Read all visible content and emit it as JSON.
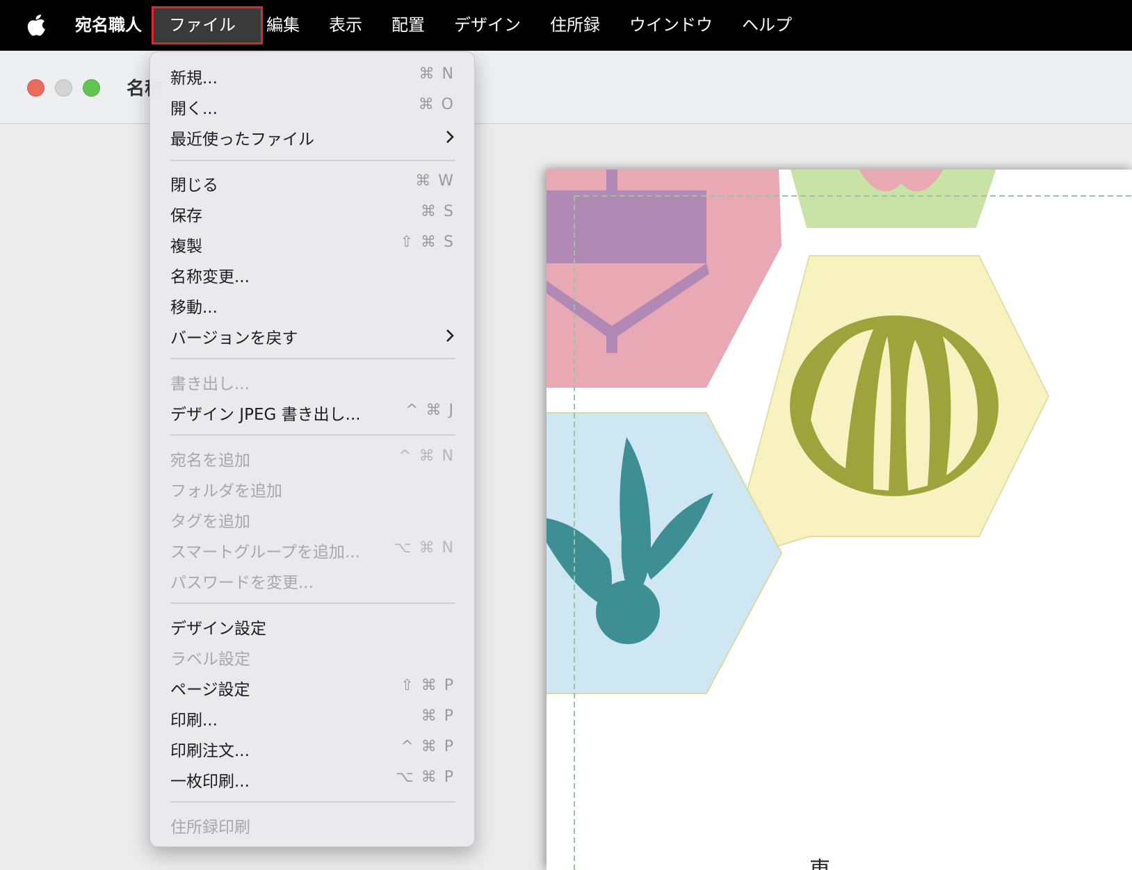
{
  "menubar": {
    "app_name": "宛名職人",
    "items": [
      "ファイル",
      "編集",
      "表示",
      "配置",
      "デザイン",
      "住所録",
      "ウインドウ",
      "ヘルプ"
    ]
  },
  "window": {
    "title": "名称"
  },
  "card": {
    "visible_char": "東"
  },
  "file_menu": {
    "items": [
      {
        "label": "新規...",
        "shortcut": "⌘ N",
        "enabled": true
      },
      {
        "label": "開く...",
        "shortcut": "⌘ O",
        "enabled": true
      },
      {
        "label": "最近使ったファイル",
        "shortcut": "",
        "submenu": true,
        "enabled": true
      },
      {
        "label": "閉じる",
        "shortcut": "⌘ W",
        "enabled": true
      },
      {
        "label": "保存",
        "shortcut": "⌘ S",
        "enabled": true
      },
      {
        "label": "複製",
        "shortcut": "⇧ ⌘ S",
        "enabled": true
      },
      {
        "label": "名称変更...",
        "shortcut": "",
        "enabled": true
      },
      {
        "label": "移動...",
        "shortcut": "",
        "enabled": true
      },
      {
        "label": "バージョンを戻す",
        "shortcut": "",
        "submenu": true,
        "enabled": true
      },
      {
        "label": "書き出し...",
        "shortcut": "",
        "enabled": false
      },
      {
        "label": "デザイン JPEG 書き出し...",
        "shortcut": "^ ⌘ J",
        "enabled": true
      },
      {
        "label": "宛名を追加",
        "shortcut": "^ ⌘ N",
        "enabled": false
      },
      {
        "label": "フォルダを追加",
        "shortcut": "",
        "enabled": false
      },
      {
        "label": "タグを追加",
        "shortcut": "",
        "enabled": false
      },
      {
        "label": "スマートグループを追加...",
        "shortcut": "⌥ ⌘ N",
        "enabled": false
      },
      {
        "label": "パスワードを変更...",
        "shortcut": "",
        "enabled": false
      },
      {
        "label": "デザイン設定",
        "shortcut": "",
        "enabled": true
      },
      {
        "label": "ラベル設定",
        "shortcut": "",
        "enabled": false
      },
      {
        "label": "ページ設定",
        "shortcut": "⇧ ⌘ P",
        "enabled": true
      },
      {
        "label": "印刷...",
        "shortcut": "⌘ P",
        "enabled": true
      },
      {
        "label": "印刷注文...",
        "shortcut": "^ ⌘ P",
        "enabled": true
      },
      {
        "label": "一枚印刷...",
        "shortcut": "⌥ ⌘ P",
        "enabled": true
      },
      {
        "label": "住所録印刷",
        "shortcut": "",
        "enabled": false
      }
    ]
  },
  "colors": {
    "menubar_bg": "#000000",
    "highlight_border": "#e2252f",
    "hex_pink": "#e8a8b4",
    "hex_green": "#c9e3a6",
    "hex_yellow": "#f8f2c0",
    "hex_blue": "#cfe6f3",
    "motif_purple": "#b08ab5",
    "motif_olive": "#9da43c",
    "motif_teal": "#3e8f93"
  }
}
